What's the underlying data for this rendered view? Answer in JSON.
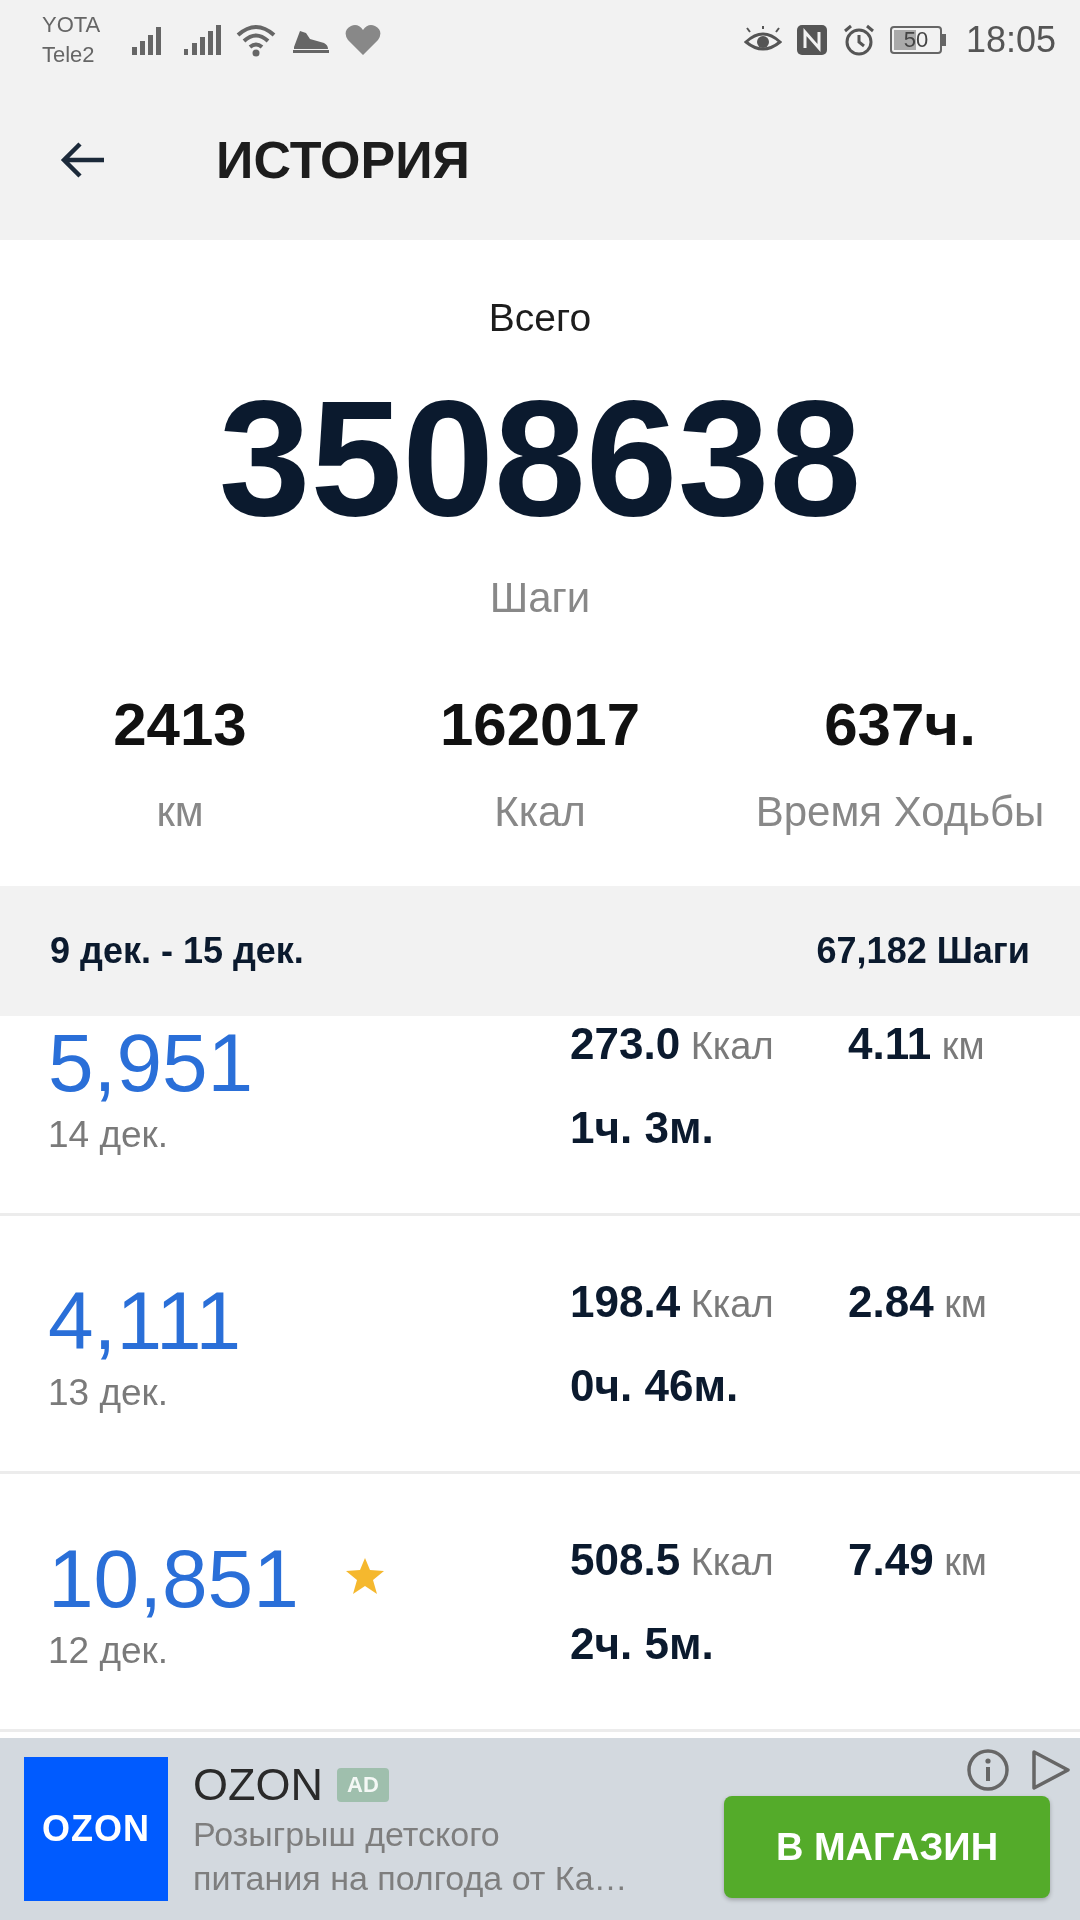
{
  "status_bar": {
    "carriers": [
      "YOTA",
      "Tele2"
    ],
    "battery": "50",
    "time": "18:05"
  },
  "header": {
    "title": "ИСТОРИЯ"
  },
  "summary": {
    "caption": "Всего",
    "total": "3508638",
    "unit": "Шаги",
    "stats": [
      {
        "value": "2413",
        "label": "км"
      },
      {
        "value": "162017",
        "label": "Ккал"
      },
      {
        "value": "637ч.",
        "label": "Время Ходьбы"
      }
    ]
  },
  "week": {
    "range": "9 дек. - 15 дек.",
    "total": "67,182 Шаги"
  },
  "days": [
    {
      "steps": "5,951",
      "date": "14 дек.",
      "starred": false,
      "kcal": "273.0",
      "kcal_unit": "Ккал",
      "km": "4.11",
      "km_unit": "км",
      "duration": "1ч. 3м."
    },
    {
      "steps": "4,111",
      "date": "13 дек.",
      "starred": false,
      "kcal": "198.4",
      "kcal_unit": "Ккал",
      "km": "2.84",
      "km_unit": "км",
      "duration": "0ч. 46м."
    },
    {
      "steps": "10,851",
      "date": "12 дек.",
      "starred": true,
      "kcal": "508.5",
      "kcal_unit": "Ккал",
      "km": "7.49",
      "km_unit": "км",
      "duration": "2ч. 5м."
    }
  ],
  "ad": {
    "logo": "OZON",
    "title": "OZON",
    "badge": "AD",
    "description": "Розыгрыш детского питания на полгода от Ка…",
    "button": "В МАГАЗИН"
  }
}
